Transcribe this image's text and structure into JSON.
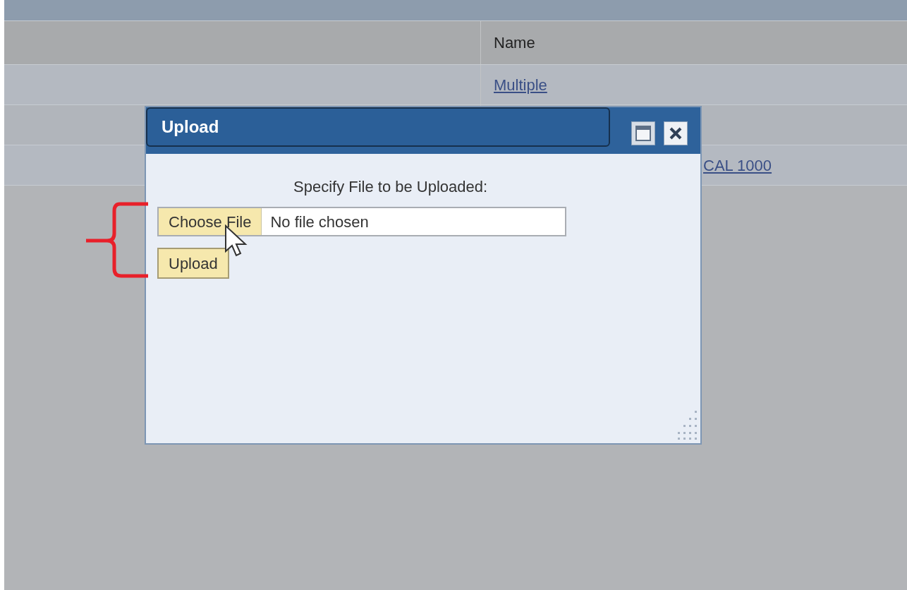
{
  "table": {
    "columns": [
      {
        "label": "Name"
      }
    ],
    "rows": [
      {
        "kind": "link",
        "name": "Multiple"
      },
      {
        "kind": "blank"
      },
      {
        "kind": "partly_covered",
        "name": "CAL 1000"
      }
    ]
  },
  "dialog": {
    "title": "Upload",
    "prompt": "Specify File to be Uploaded:",
    "file_button": "Choose File",
    "file_status": "No file chosen",
    "upload_button": "Upload"
  }
}
